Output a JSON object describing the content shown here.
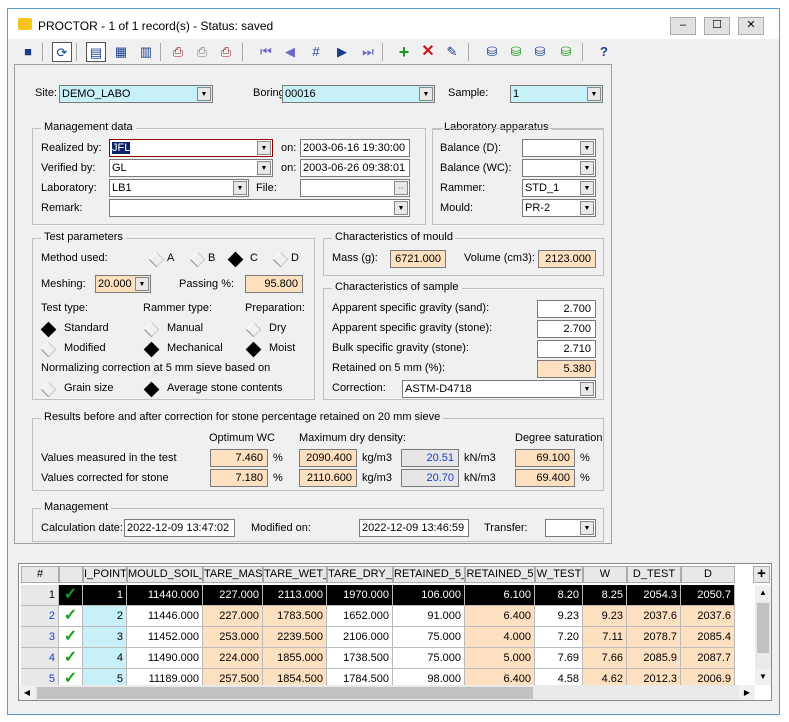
{
  "window": {
    "title": "PROCTOR - 1 of 1 record(s) - Status: saved"
  },
  "header": {
    "site_label": "Site:",
    "site": "DEMO_LABO",
    "boring_label": "Boring:",
    "boring": "00016",
    "sample_label": "Sample:",
    "sample": "1"
  },
  "management_data": {
    "title": "Management data",
    "realized_label": "Realized by:",
    "realized": "JFL",
    "on1_label": "on:",
    "realized_on": "2003-06-16 19:30:00",
    "verified_label": "Verified by:",
    "verified": "GL",
    "on2_label": "on:",
    "verified_on": "2003-06-26 09:38:01",
    "laboratory_label": "Laboratory:",
    "laboratory": "LB1",
    "file_label": "File:",
    "file": "",
    "remark_label": "Remark:",
    "remark": ""
  },
  "lab_apparatus": {
    "title": "Laboratory apparatus",
    "balance_d_label": "Balance (D):",
    "balance_d": "",
    "balance_wc_label": "Balance (WC):",
    "balance_wc": "",
    "rammer_label": "Rammer:",
    "rammer": "STD_1",
    "mould_label": "Mould:",
    "mould": "PR-2"
  },
  "test_params": {
    "title": "Test parameters",
    "method_label": "Method used:",
    "methods": [
      "A",
      "B",
      "C",
      "D"
    ],
    "meshing_label": "Meshing:",
    "meshing": "20.000",
    "passing_label": "Passing %:",
    "passing": "95.800",
    "test_type_label": "Test type:",
    "rammer_type_label": "Rammer type:",
    "preparation_label": "Preparation:",
    "standard": "Standard",
    "modified": "Modified",
    "manual": "Manual",
    "mechanical": "Mechanical",
    "dry": "Dry",
    "moist": "Moist",
    "normalizing_label": "Normalizing correction at 5 mm sieve based on",
    "grain_size": "Grain size",
    "average_stone": "Average stone contents"
  },
  "mould_chars": {
    "title": "Characteristics of mould",
    "mass_label": "Mass (g):",
    "mass": "6721.000",
    "volume_label": "Volume (cm3):",
    "volume": "2123.000"
  },
  "sample_chars": {
    "title": "Characteristics of sample",
    "asg_sand_label": "Apparent specific gravity (sand):",
    "asg_sand": "2.700",
    "asg_stone_label": "Apparent specific gravity (stone):",
    "asg_stone": "2.700",
    "bsg_stone_label": "Bulk specific gravity (stone):",
    "bsg_stone": "2.710",
    "retained_label": "Retained on 5 mm (%):",
    "retained": "5.380",
    "correction_label": "Correction:",
    "correction": "ASTM-D4718"
  },
  "results": {
    "title": "Results before and after correction for stone percentage retained on 20 mm sieve",
    "opt_wc_label": "Optimum WC",
    "max_dd_label": "Maximum dry density:",
    "deg_sat_label": "Degree saturation",
    "measured_label": "Values measured in the test",
    "measured_wc": "7.460",
    "measured_dd": "2090.400",
    "measured_kn": "20.51",
    "measured_sat": "69.100",
    "corrected_label": "Values corrected for stone",
    "corrected_wc": "7.180",
    "corrected_dd": "2110.600",
    "corrected_kn": "20.70",
    "corrected_sat": "69.400",
    "pct": "%",
    "kgm3": "kg/m3",
    "knm3": "kN/m3"
  },
  "management": {
    "title": "Management",
    "calc_label": "Calculation date:",
    "calc_date": "2022-12-09 13:47:02",
    "modified_label": "Modified on:",
    "modified": "2022-12-09 13:46:59",
    "transfer_label": "Transfer:",
    "transfer": ""
  },
  "grid": {
    "columns": [
      "#",
      "",
      "I_POINT",
      "MOULD_SOIL_",
      "TARE_MAS",
      "TARE_WET_",
      "TARE_DRY_",
      "RETAINED_5_",
      "RETAINED_5",
      "W_TEST",
      "W",
      "D_TEST",
      "D"
    ],
    "rows": [
      [
        "1",
        "✓",
        "1",
        "11440.000",
        "227.000",
        "2113.000",
        "1970.000",
        "106.000",
        "6.100",
        "8.20",
        "8.25",
        "2054.3",
        "2050.7"
      ],
      [
        "2",
        "✓",
        "2",
        "11446.000",
        "227.000",
        "1783.500",
        "1652.000",
        "91.000",
        "6.400",
        "9.23",
        "9.23",
        "2037.6",
        "2037.6"
      ],
      [
        "3",
        "✓",
        "3",
        "11452.000",
        "253.000",
        "2239.500",
        "2106.000",
        "75.000",
        "4.000",
        "7.20",
        "7.11",
        "2078.7",
        "2085.4"
      ],
      [
        "4",
        "✓",
        "4",
        "11490.000",
        "224.000",
        "1855.000",
        "1738.500",
        "75.000",
        "5.000",
        "7.69",
        "7.66",
        "2085.9",
        "2087.7"
      ],
      [
        "5",
        "✓",
        "5",
        "11189.000",
        "257.500",
        "1854.500",
        "1784.500",
        "98.000",
        "6.400",
        "4.58",
        "4.62",
        "2012.3",
        "2006.9"
      ]
    ]
  }
}
